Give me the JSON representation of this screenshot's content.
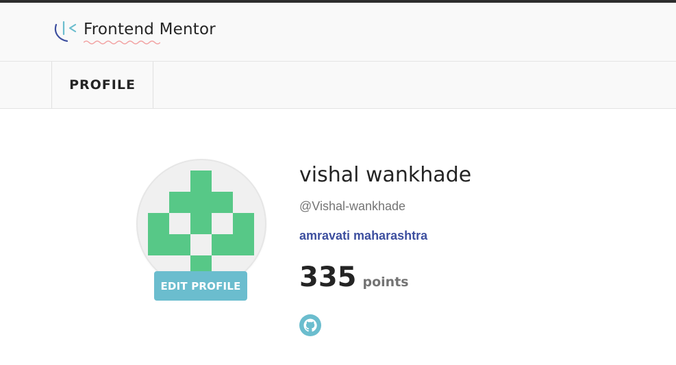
{
  "header": {
    "logo_text": "Frontend Mentor",
    "logo_icon": "frontend-mentor-logo-icon"
  },
  "nav": {
    "tabs": [
      {
        "label": "PROFILE",
        "active": true
      }
    ]
  },
  "profile": {
    "avatar_icon": "identicon-avatar",
    "edit_button_label": "EDIT PROFILE",
    "name": "vishal wankhade",
    "handle": "@Vishal-wankhade",
    "location": "amravati maharashtra",
    "points_value": "335",
    "points_label": "points",
    "social_icon": "github-icon"
  },
  "colors": {
    "accent": "#6bbdce",
    "location_link": "#3d4f9f",
    "identicon_green": "#57c887",
    "logo_squiggle": "#f2a3a3"
  }
}
